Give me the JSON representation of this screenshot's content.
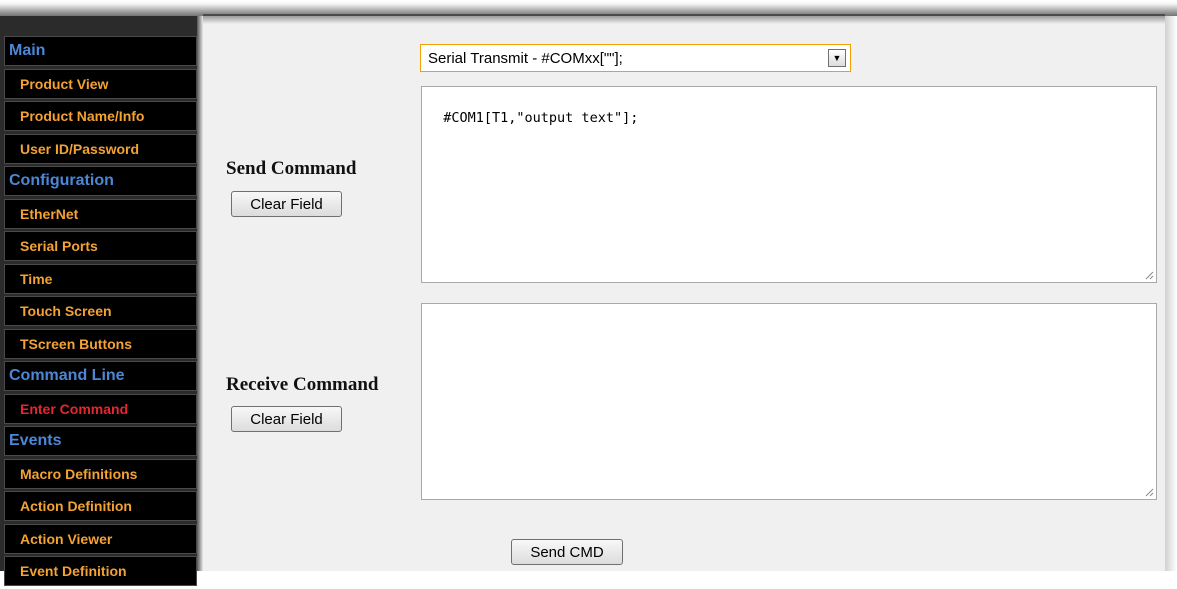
{
  "sidebar": {
    "items": [
      {
        "type": "header",
        "label": "Main"
      },
      {
        "type": "link",
        "label": "Product View"
      },
      {
        "type": "link",
        "label": "Product Name/Info"
      },
      {
        "type": "link",
        "label": "User ID/Password"
      },
      {
        "type": "header",
        "label": "Configuration"
      },
      {
        "type": "link",
        "label": "EtherNet"
      },
      {
        "type": "link",
        "label": "Serial Ports"
      },
      {
        "type": "link",
        "label": "Time"
      },
      {
        "type": "link",
        "label": "Touch Screen"
      },
      {
        "type": "link",
        "label": "TScreen Buttons"
      },
      {
        "type": "header",
        "label": "Command Line"
      },
      {
        "type": "link",
        "label": "Enter Command",
        "active": true
      },
      {
        "type": "header",
        "label": "Events"
      },
      {
        "type": "link",
        "label": "Macro Definitions"
      },
      {
        "type": "link",
        "label": "Action Definition"
      },
      {
        "type": "link",
        "label": "Action Viewer"
      },
      {
        "type": "link",
        "label": "Event Definition"
      }
    ]
  },
  "command": {
    "select_value": "Serial Transmit - #COMxx[\"\"];",
    "send_label": "Send Command",
    "send_text": "#COM1[T1,\"output text\"];",
    "receive_label": "Receive Command",
    "receive_text": "",
    "clear_field_label": "Clear Field",
    "send_cmd_label": "Send CMD"
  },
  "colors": {
    "header_text": "#4c87d6",
    "link_text": "#f3a233",
    "active_link_text": "#e4262f",
    "content_bg": "#f0f0f0",
    "select_border": "#f0a000"
  }
}
